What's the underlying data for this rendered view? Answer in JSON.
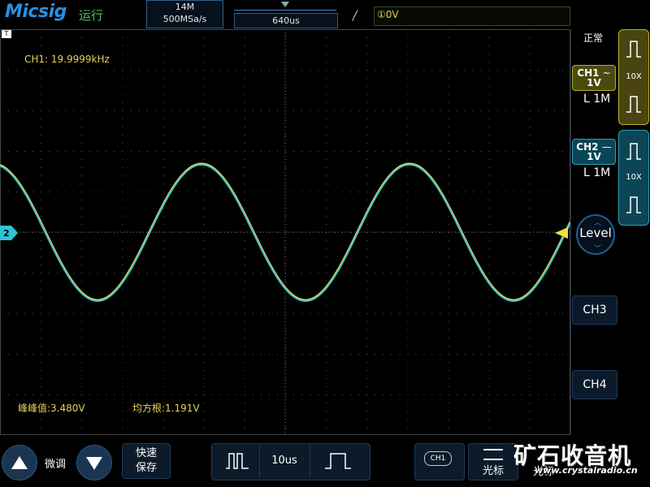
{
  "header": {
    "brand": "Micsig",
    "run_status": "运行",
    "memory_depth": "14M",
    "sample_rate": "500MSa/s",
    "timebase_position": "640us",
    "trigger_edge_symbol": "/",
    "trigger_info": "①0V"
  },
  "screen": {
    "frequency_readout": "CH1: 19.9999kHz",
    "peak_to_peak": "峰峰值:3.480V",
    "rms": "均方根:1.191V",
    "trigger_position_marker": "T",
    "channel_marker": "2",
    "colors": {
      "ch1": "#e8d25a",
      "ch2": "#2ec4d6",
      "grid": "#5a5a5a"
    }
  },
  "right_panel": {
    "acquisition_mode": "正常",
    "ch1": {
      "label": "CH1",
      "coupling_symbol": "~",
      "scale": "1V",
      "impedance": "L 1M",
      "probe": "10X"
    },
    "ch2": {
      "label": "CH2",
      "coupling_symbol": "—",
      "scale": "1V",
      "impedance": "L 1M",
      "probe": "10X"
    },
    "level_label": "Level",
    "ch3_label": "CH3",
    "ch4_label": "CH4"
  },
  "bottom": {
    "fine_adjust_label": "微调",
    "quick_save_label_1": "快速",
    "quick_save_label_2": "保存",
    "timebase_value": "10us",
    "channel_select_label": "CH1",
    "cursor_label": "光标",
    "cursor_label_2": "光标"
  },
  "watermark": {
    "text": "矿石收音机",
    "url": "www.crystalradio.cn"
  }
}
